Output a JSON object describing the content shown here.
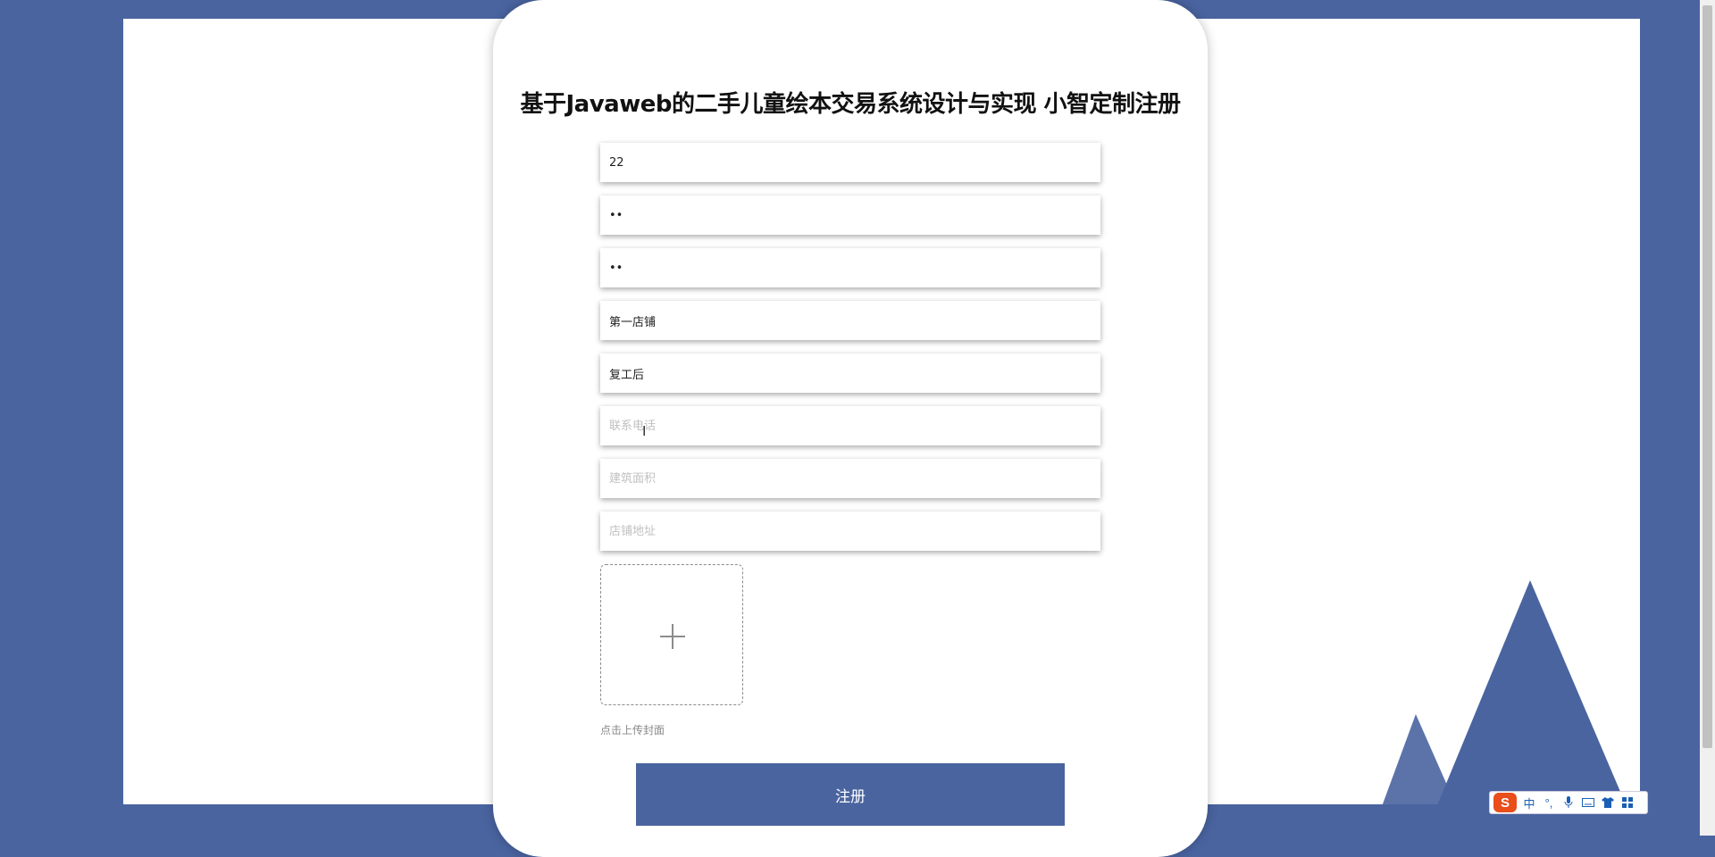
{
  "page": {
    "title": "基于Javaweb的二手儿童绘本交易系统设计与实现 小智定制注册"
  },
  "form": {
    "fields": [
      {
        "name": "username",
        "type": "text",
        "value": "22",
        "placeholder": ""
      },
      {
        "name": "password",
        "type": "password",
        "value": "22",
        "placeholder": ""
      },
      {
        "name": "confirm-password",
        "type": "password",
        "value": "22",
        "placeholder": ""
      },
      {
        "name": "shop-name",
        "type": "text",
        "value": "第一店铺",
        "placeholder": ""
      },
      {
        "name": "owner-name",
        "type": "text",
        "value": "复工后",
        "placeholder": ""
      },
      {
        "name": "phone",
        "type": "text",
        "value": "",
        "placeholder": "联系电话"
      },
      {
        "name": "building-area",
        "type": "text",
        "value": "",
        "placeholder": "建筑面积"
      },
      {
        "name": "shop-address",
        "type": "text",
        "value": "",
        "placeholder": "店铺地址"
      }
    ],
    "upload_hint": "点击上传封面",
    "submit_label": "注册"
  },
  "ime": {
    "logo": "S",
    "mode": "中",
    "punct": "°,",
    "icons": [
      "microphone-icon",
      "keyboard-icon",
      "skin-icon",
      "toolbox-icon"
    ]
  },
  "colors": {
    "primary": "#4a64a0",
    "background": "#4a64a0"
  }
}
